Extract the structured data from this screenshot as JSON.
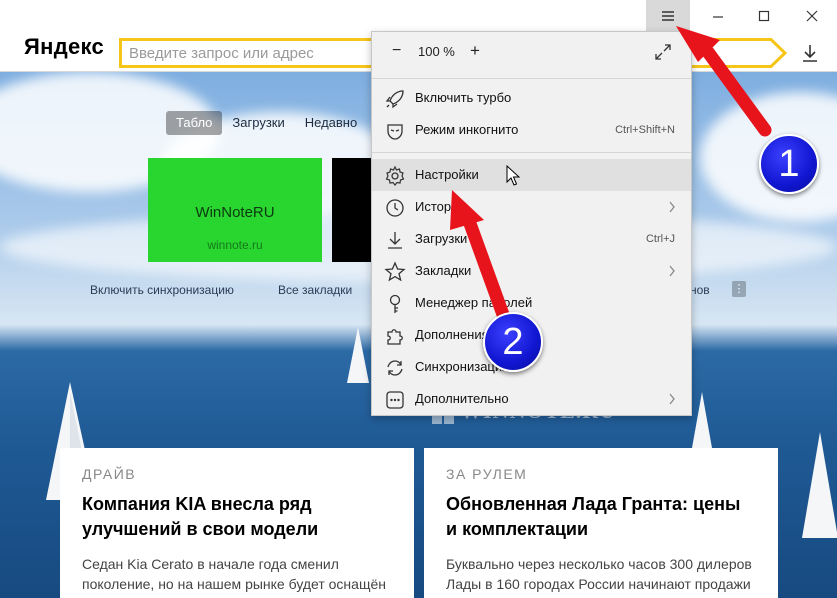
{
  "window": {
    "menu_icon": "hamburger-icon",
    "minimize_icon": "minimize-icon",
    "maximize_icon": "maximize-icon",
    "close_icon": "close-icon"
  },
  "toolbar": {
    "logo": "Яндекс",
    "address_placeholder": "Введите запрос или адрес",
    "download_icon": "download-icon"
  },
  "newtab": {
    "tabs": [
      "Табло",
      "Загрузки",
      "Недавно"
    ],
    "tiles": [
      {
        "title": "WinNoteRU",
        "subtitle": "winnote.ru",
        "color": "#29d630"
      },
      {
        "title": "",
        "subtitle": "",
        "color": "#000000"
      }
    ],
    "links": {
      "sync": "Включить синхронизацию",
      "bookmarks": "Все закладки",
      "extra": "нов",
      "more": "⋮"
    }
  },
  "watermark": "WINNOTE.RU",
  "cards": [
    {
      "source": "ДРАЙВ",
      "title": "Компания KIA внесла ряд улучшений в свои модели",
      "text": "Седан Kia Cerato в начале года сменил поколение, но на нашем рынке будет оснащён"
    },
    {
      "source": "ЗА РУЛЕМ",
      "title": "Обновленная Лада Гранта: цены и комплектации",
      "text": "Буквально через несколько часов 300 дилеров Лады в 160 городах России начинают продажи"
    }
  ],
  "menu": {
    "zoom": {
      "minus": "−",
      "value": "100 %",
      "plus": "+"
    },
    "items": [
      {
        "label": "Включить турбо",
        "icon": "rocket-icon",
        "shortcut": "",
        "submenu": false
      },
      {
        "label": "Режим инкогнито",
        "icon": "incognito-mask-icon",
        "shortcut": "Ctrl+Shift+N",
        "submenu": false
      },
      {
        "label": "Настройки",
        "icon": "gear-icon",
        "shortcut": "",
        "submenu": false,
        "hovered": true
      },
      {
        "label": "История",
        "icon": "clock-icon",
        "shortcut": "",
        "submenu": true
      },
      {
        "label": "Загрузки",
        "icon": "download-icon",
        "shortcut": "Ctrl+J",
        "submenu": false
      },
      {
        "label": "Закладки",
        "icon": "star-icon",
        "shortcut": "",
        "submenu": true
      },
      {
        "label": "Менеджер паролей",
        "icon": "key-icon",
        "shortcut": "",
        "submenu": false
      },
      {
        "label": "Дополнения",
        "icon": "puzzle-icon",
        "shortcut": "",
        "submenu": false
      },
      {
        "label": "Синхронизация",
        "icon": "sync-icon",
        "shortcut": "",
        "submenu": false
      },
      {
        "label": "Дополнительно",
        "icon": "more-dots-icon",
        "shortcut": "",
        "submenu": true
      }
    ]
  },
  "annotations": [
    {
      "number": "1",
      "color": "#e8141c"
    },
    {
      "number": "2",
      "color": "#e8141c"
    }
  ]
}
